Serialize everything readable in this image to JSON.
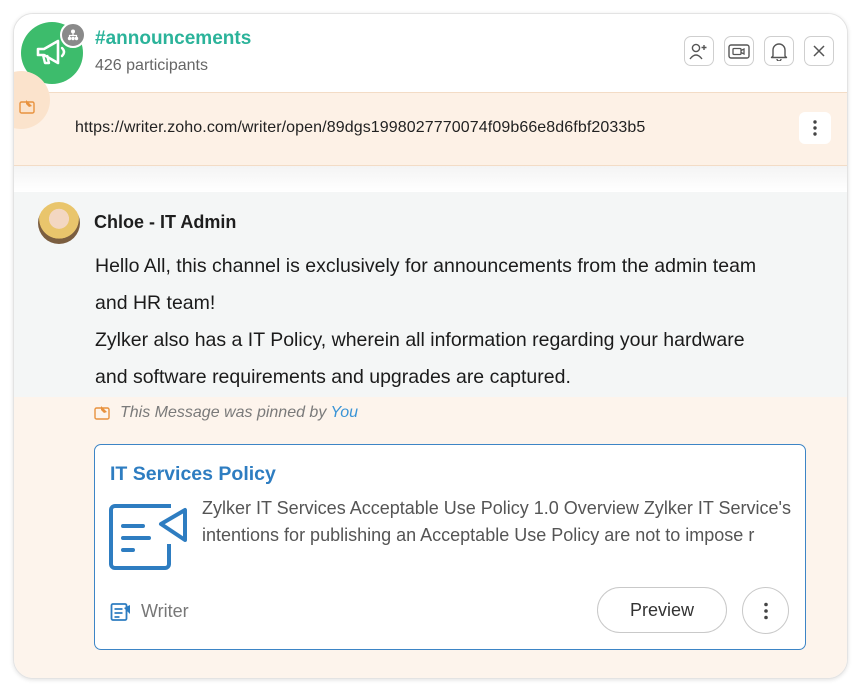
{
  "channel": {
    "name": "#announcements",
    "participants": "426 participants",
    "icon": "megaphone-icon",
    "accent_color": "#3dbc6c",
    "title_color": "#2bb39a"
  },
  "header_actions": [
    {
      "name": "add-participant-button",
      "icon": "add-user-icon"
    },
    {
      "name": "video-call-button",
      "icon": "video-icon"
    },
    {
      "name": "notifications-button",
      "icon": "bell-icon"
    },
    {
      "name": "close-button",
      "icon": "close-icon"
    }
  ],
  "pinned_bar": {
    "url": "https://writer.zoho.com/writer/open/89dgs1998027770074f09b66e8d6fbf2033b5",
    "icon": "pin-icon",
    "menu_icon": "more-vertical-icon"
  },
  "message": {
    "author": "Chloe - IT Admin",
    "lines": [
      "Hello All, this channel is exclusively for announcements from the admin team",
      "and HR team!",
      "Zylker also has a IT Policy, wherein all information regarding your hardware",
      "and software requirements and upgrades are captured."
    ],
    "pinned_note_prefix": "This Message was pinned by",
    "pinned_by": "You"
  },
  "card": {
    "title": "IT Services Policy",
    "description": "Zylker IT Services Acceptable Use Policy   1.0 Overview   Zylker IT Service's intentions for publishing an Acceptable Use Policy are not to impose r",
    "source": "Writer",
    "preview_label": "Preview",
    "accent_color": "#2e7dc1"
  }
}
